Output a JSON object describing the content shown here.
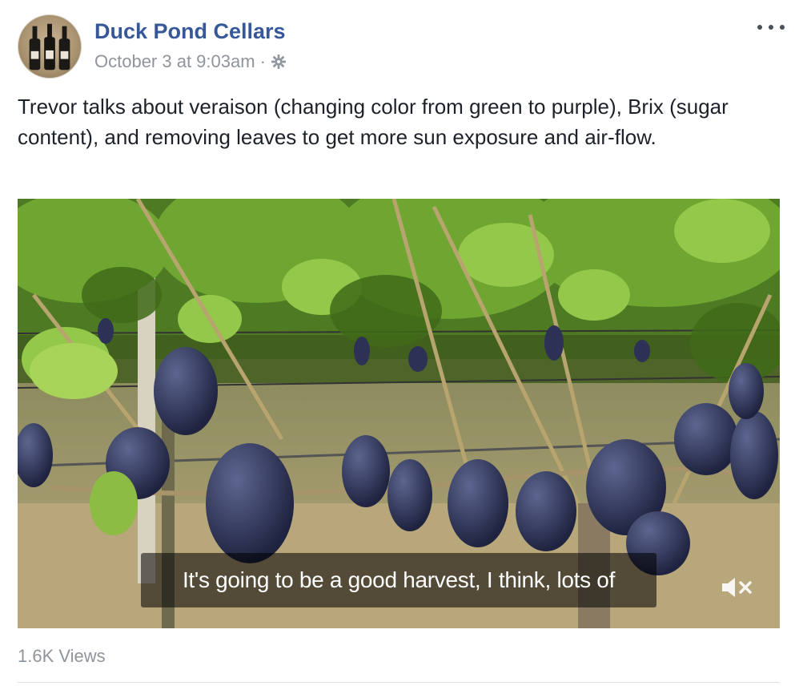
{
  "post": {
    "page_name": "Duck Pond Cellars",
    "timestamp": "October 3 at 9:03am",
    "separator": "·",
    "audience_icon": "gear-icon",
    "more_icon": "more-options-icon",
    "text": "Trevor talks about veraison (changing color from green to purple), Brix (sugar content), and removing leaves to get more sun exposure and air-flow.",
    "video": {
      "caption": "It's going to be a good harvest, I think, lots of",
      "mute_icon": "mute-icon"
    },
    "views": "1.6K Views"
  },
  "colors": {
    "link_blue": "#365899",
    "meta_gray": "#90949c",
    "text": "#1d2129",
    "divider": "#dddfe2"
  }
}
